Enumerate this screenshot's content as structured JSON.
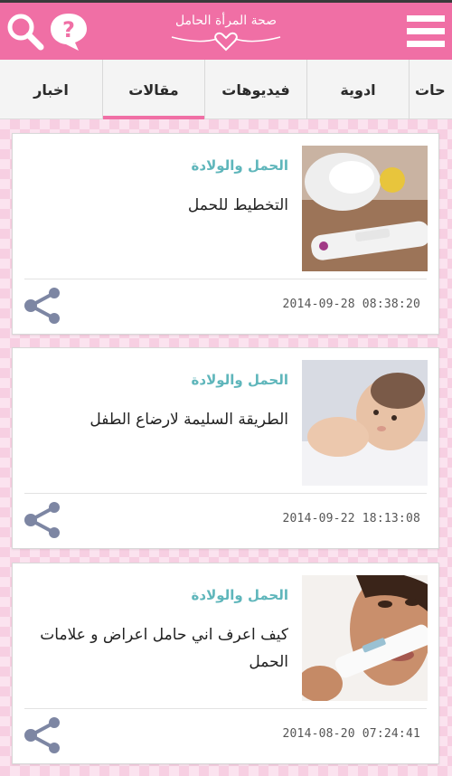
{
  "header": {
    "app_title": "صحة المرأة الحامل",
    "menu_icon": "hamburger-menu-icon",
    "search_icon": "search-icon",
    "help_icon": "question-bubble-icon",
    "brand_color": "#f06fa5"
  },
  "tabs": [
    {
      "label": "اخبار",
      "active": false
    },
    {
      "label": "مقالات",
      "active": true
    },
    {
      "label": "فيديوهات",
      "active": false
    },
    {
      "label": "ادوية",
      "active": false
    },
    {
      "label": "حات",
      "active": false
    }
  ],
  "articles": [
    {
      "category": "الحمل والولادة",
      "title": "التخطيط للحمل",
      "date": "2014-09-28 08:38:20",
      "image": "pregnancy-test-photo"
    },
    {
      "category": "الحمل والولادة",
      "title": "الطريقة السليمة لارضاع الطفل",
      "date": "2014-09-22 18:13:08",
      "image": "newborn-baby-photo"
    },
    {
      "category": "الحمل والولادة",
      "title": "كيف اعرف اني حامل اعراض و علامات الحمل",
      "date": "2014-08-20 07:24:41",
      "image": "woman-holding-test-photo"
    }
  ],
  "colors": {
    "category_text": "#5fb6bb",
    "share_icon": "#7d86a3",
    "active_tab_underline": "#f06fa5"
  }
}
